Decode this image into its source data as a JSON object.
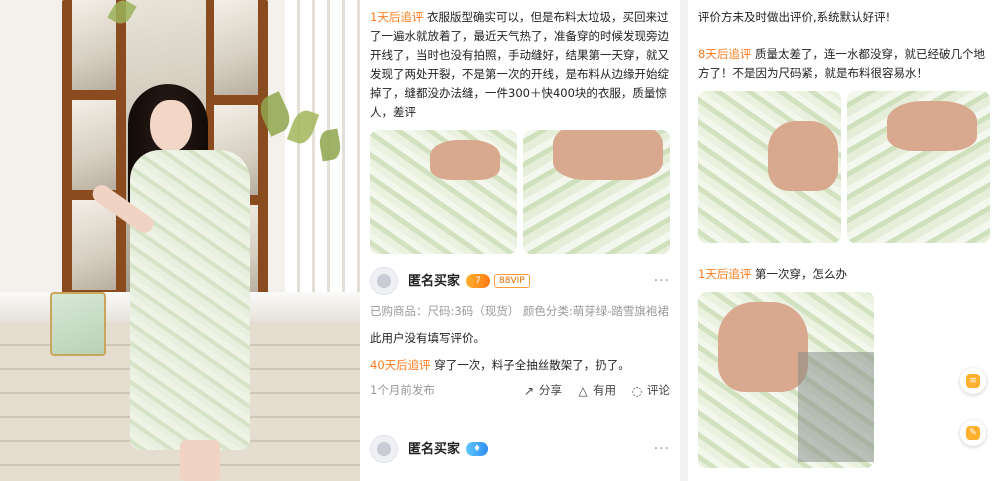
{
  "left_photo": {
    "description_icon": "product-photo"
  },
  "middle": {
    "review1": {
      "tag": "1天后追评",
      "text": "衣服版型确实可以，但是布料太垃圾，买回来过了一遍水就放着了，最近天气热了，准备穿的时候发现旁边开线了，当时也没有拍照，手动缝好，结果第一天穿，就又发现了两处开裂，不是第一次的开线，是布料从边缘开始绽掉了，缝都没办法缝，一件300＋快400块的衣服，质量惊人，差评"
    },
    "review2": {
      "username": "匿名买家",
      "level_badge": "7",
      "vip_badge": "88VIP",
      "more": "···",
      "purchase_info": "已购商品：尺码:3码（现货）    颜色分类:萌芽绿-踏雪旗袍裙",
      "comment": "此用户没有填写评价。",
      "followup_tag": "40天后追评",
      "followup_text": "穿了一次，料子全抽丝散架了，扔了。",
      "time": "1个月前发布",
      "share_label": "分享",
      "useful_label": "有用",
      "comment_label": "评论"
    },
    "review3": {
      "username": "匿名买家",
      "more": "···"
    }
  },
  "right": {
    "top_text": "评价方未及时做出评价,系统默认好评!",
    "review1": {
      "tag": "8天后追评",
      "text": "质量太差了，连一水都没穿，就已经破几个地方了！不是因为尺码紧，就是布料很容易水！"
    },
    "review2": {
      "tag": "1天后追评",
      "text": "第一次穿，怎么办"
    },
    "float_buttons": [
      "note-icon",
      "feedback-icon"
    ]
  },
  "colors": {
    "accent_orange": "#ff7a1c",
    "muted_gray": "#999999"
  }
}
